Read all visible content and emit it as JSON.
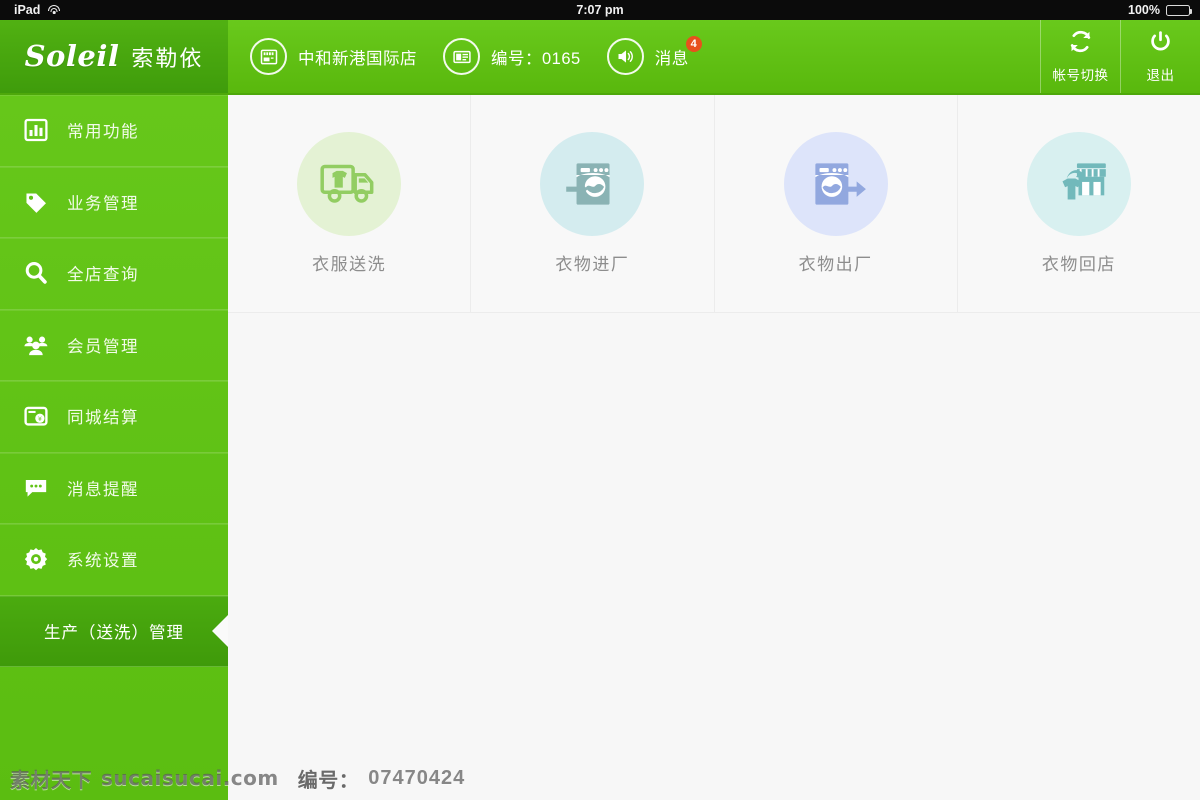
{
  "statusbar": {
    "device": "iPad",
    "wifi_icon": "wifi-icon",
    "time": "7:07 pm",
    "battery_percent": "100%",
    "battery_icon": "battery-full-icon"
  },
  "header": {
    "logo_script": "Soleil",
    "logo_cn": "索勒依",
    "items": [
      {
        "icon": "store-icon",
        "label": "中和新港国际店"
      },
      {
        "icon": "id-card-icon",
        "label": "编号：0165"
      },
      {
        "icon": "speaker-icon",
        "label": "消息",
        "badge": "4"
      }
    ],
    "actions": [
      {
        "icon": "refresh-icon",
        "label": "帐号切换"
      },
      {
        "icon": "power-icon",
        "label": "退出"
      }
    ]
  },
  "sidebar": {
    "items": [
      {
        "icon": "chart-bar-icon",
        "label": "常用功能",
        "active": false
      },
      {
        "icon": "tag-icon",
        "label": "业务管理",
        "active": false
      },
      {
        "icon": "search-icon",
        "label": "全店查询",
        "active": false
      },
      {
        "icon": "users-icon",
        "label": "会员管理",
        "active": false
      },
      {
        "icon": "wallet-yuan-icon",
        "label": "同城结算",
        "active": false
      },
      {
        "icon": "chat-bubble-icon",
        "label": "消息提醒",
        "active": false
      },
      {
        "icon": "gear-icon",
        "label": "系统设置",
        "active": false
      },
      {
        "icon": "",
        "label": "生产（送洗）管理",
        "active": true
      }
    ]
  },
  "main": {
    "tiles": [
      {
        "icon": "truck-shirt-icon",
        "label": "衣服送洗",
        "circle_color": "#e4f2d4",
        "glyph_color": "#8fcc5f"
      },
      {
        "icon": "washer-in-icon",
        "label": "衣物进厂",
        "circle_color": "#d4ecef",
        "glyph_color": "#87b2b3"
      },
      {
        "icon": "washer-out-icon",
        "label": "衣物出厂",
        "circle_color": "#dde4fa",
        "glyph_color": "#8fa5dd"
      },
      {
        "icon": "shirt-store-icon",
        "label": "衣物回店",
        "circle_color": "#d8f0f0",
        "glyph_color": "#72b9bb"
      }
    ]
  },
  "watermark": {
    "brand_cn": "素材天下",
    "site": "sucaisucai.com",
    "number_label": "编号：",
    "number": "07470424"
  },
  "colors": {
    "brand_green": "#62c316",
    "brand_green_dark": "#4aa910",
    "active_green": "#46a40d",
    "badge_red": "#e8511d",
    "main_bg": "#f7f7f7"
  }
}
